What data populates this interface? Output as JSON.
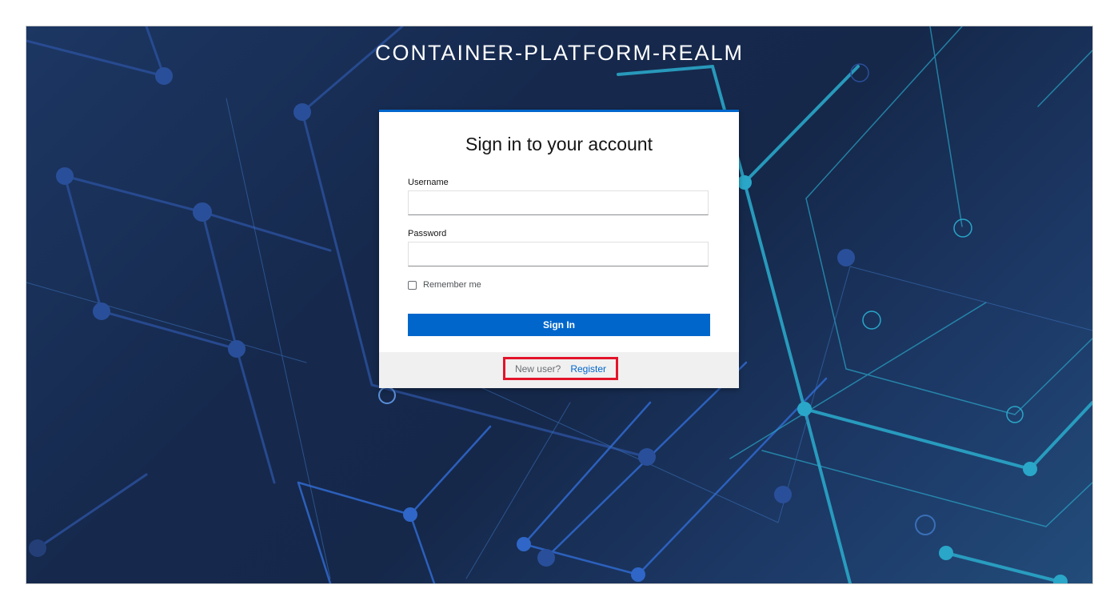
{
  "realm": {
    "title": "CONTAINER-PLATFORM-REALM"
  },
  "login": {
    "heading": "Sign in to your account",
    "username_label": "Username",
    "username_value": "",
    "password_label": "Password",
    "password_value": "",
    "remember_label": "Remember me",
    "remember_checked": false,
    "signin_label": "Sign In"
  },
  "footer": {
    "new_user_text": "New user?",
    "register_label": "Register"
  },
  "colors": {
    "accent": "#0066cc",
    "highlight_box": "#e3142a",
    "background_dark": "#15284a"
  }
}
